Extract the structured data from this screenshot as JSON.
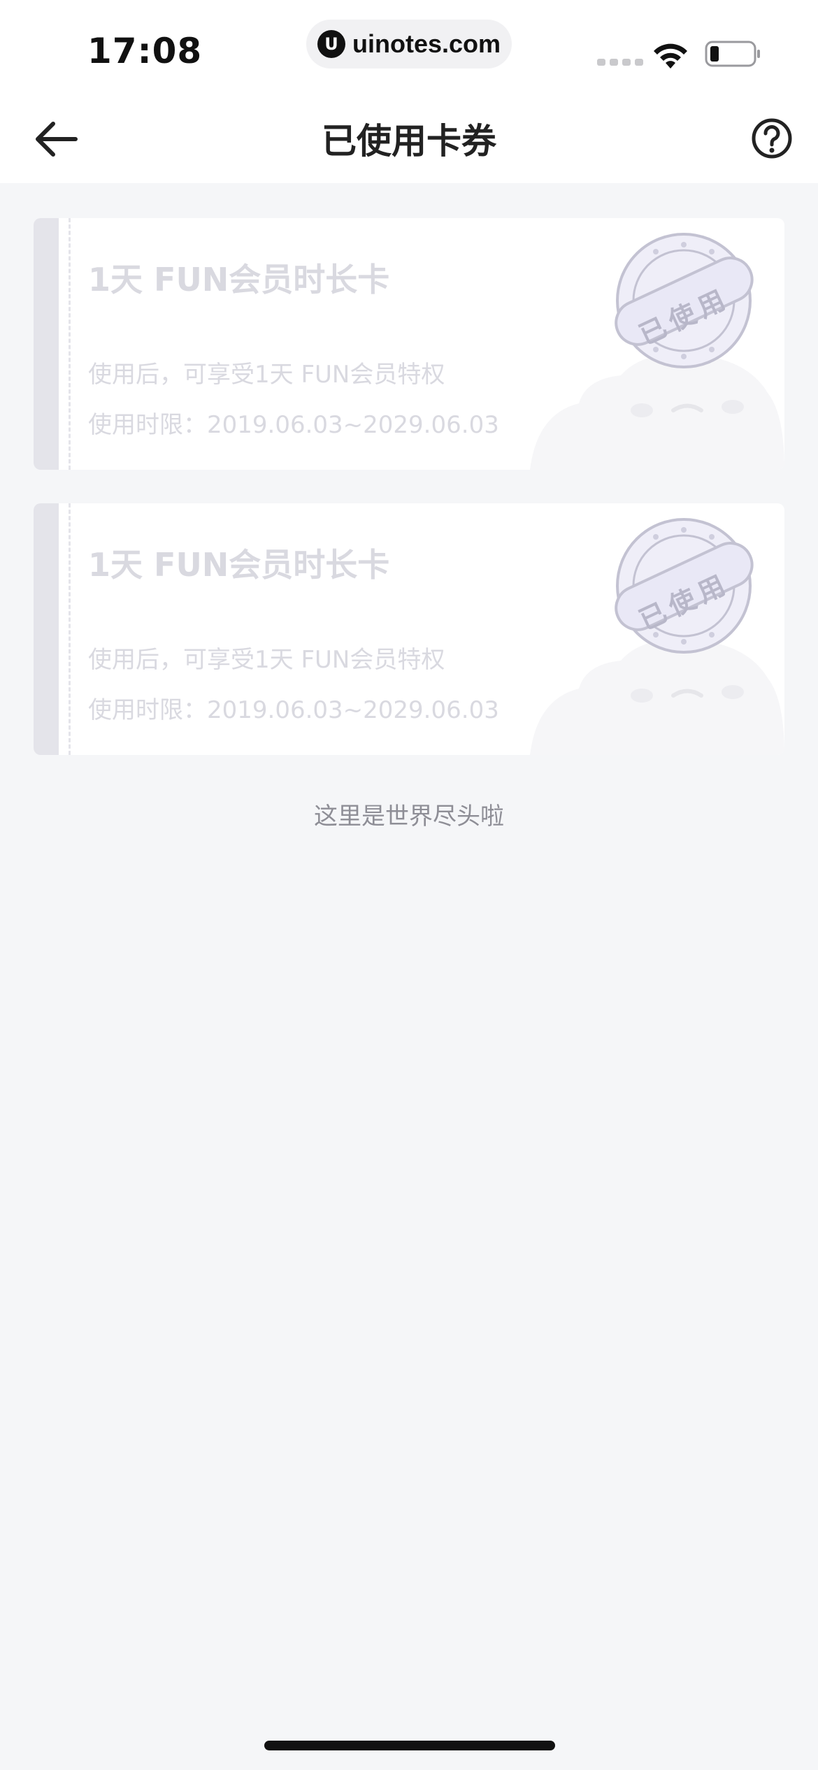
{
  "status_bar": {
    "time": "17:08",
    "url": "uinotes.com",
    "url_logo": "U"
  },
  "nav": {
    "title": "已使用卡券",
    "back_icon": "arrow-left-icon",
    "help_icon": "question-circle-icon"
  },
  "coupons": [
    {
      "title": "1天 FUN会员时长卡",
      "description": "使用后，可享受1天 FUN会员特权",
      "validity": "使用时限：2019.06.03~2029.06.03",
      "stamp": "已使用"
    },
    {
      "title": "1天 FUN会员时长卡",
      "description": "使用后，可享受1天 FUN会员特权",
      "validity": "使用时限：2019.06.03~2029.06.03",
      "stamp": "已使用"
    }
  ],
  "end_text": "这里是世界尽头啦",
  "colors": {
    "background": "#f5f6f8",
    "card": "#ffffff",
    "faded_text": "#d9d9e0",
    "stamp_fill": "#ecebf7",
    "stamp_stroke": "#c3c2d2"
  }
}
